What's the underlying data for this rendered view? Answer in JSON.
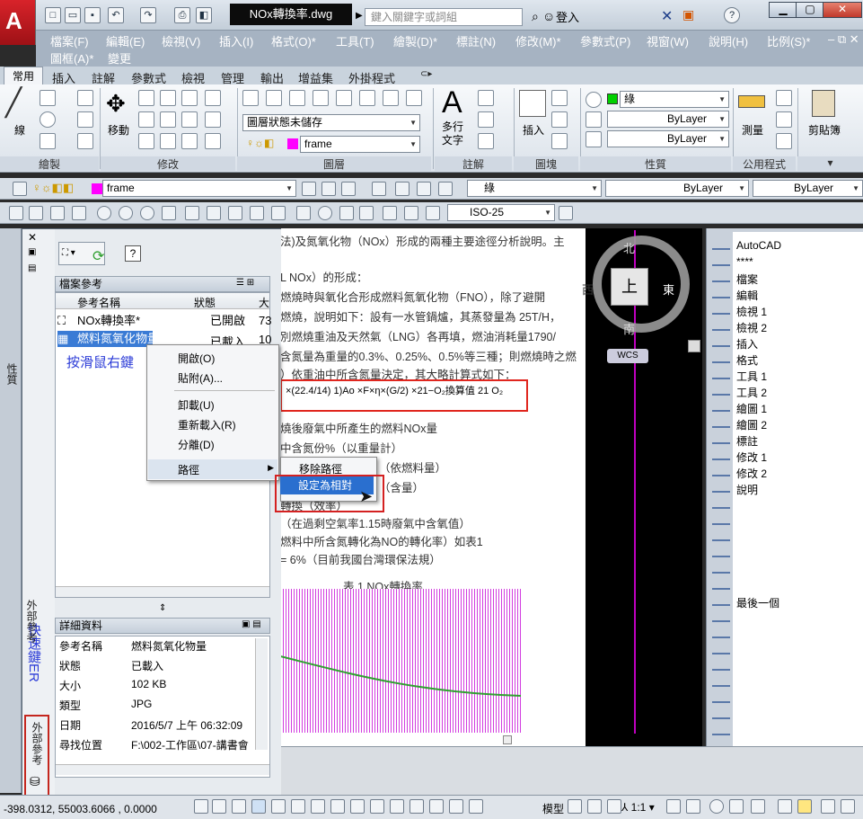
{
  "title_bar": {
    "document_title": "NOx轉換率.dwg",
    "search_placeholder": "鍵入關鍵字或詞組",
    "login_label": "登入",
    "help_label": "?"
  },
  "menu": {
    "row1": [
      "檔案(F)",
      "編輯(E)",
      "檢視(V)",
      "插入(I)",
      "格式(O)*",
      "工具(T)",
      "繪製(D)*",
      "標註(N)",
      "修改(M)*",
      "參數式(P)",
      "視窗(W)",
      "說明(H)",
      "比例(S)*"
    ],
    "row2": [
      "圖框(A)*",
      "變更"
    ]
  },
  "ribbon": {
    "tabs": [
      "常用",
      "插入",
      "註解",
      "參數式",
      "檢視",
      "管理",
      "輸出",
      "增益集",
      "外掛程式"
    ],
    "draw": {
      "line_label": "線",
      "panel": "繪製"
    },
    "modify": {
      "move_label": "移動",
      "panel": "修改"
    },
    "layer": {
      "state_combo": "圖層狀態未儲存",
      "layer_combo": "frame",
      "panel": "圖層"
    },
    "annotation": {
      "mtext_label": "多行\n文字",
      "panel": "註解"
    },
    "block": {
      "insert_label": "插入",
      "panel": "圖塊"
    },
    "properties": {
      "color_combo": "綠",
      "linetype_combo": "ByLayer",
      "lineweight_combo": "ByLayer",
      "panel": "性質"
    },
    "utilities": {
      "measure_label": "測量",
      "panel": "公用程式"
    },
    "clipboard": {
      "paste_label": "剪貼簿"
    }
  },
  "toolbar1": {
    "layer_combo": "frame",
    "color_combo": "綠",
    "linetype_combo": "ByLayer",
    "lineweight_combo": "ByLayer"
  },
  "toolbar2": {
    "dimstyle_combo": "ISO-25"
  },
  "xref_palette": {
    "file_refs_header": "檔案參考",
    "columns": [
      "參考名稱",
      "狀態",
      "大"
    ],
    "rows": [
      {
        "name": "NOx轉換率*",
        "status": "已開啟",
        "size": "73"
      },
      {
        "name": "燃料氮氧化物量",
        "status": "已載入",
        "size": "10"
      }
    ],
    "annotation": "按滑鼠右鍵",
    "details_header": "詳細資料",
    "details": [
      {
        "key": "參考名稱",
        "value": "燃料氮氧化物量"
      },
      {
        "key": "狀態",
        "value": "已載入"
      },
      {
        "key": "大小",
        "value": "102 KB"
      },
      {
        "key": "類型",
        "value": "JPG"
      },
      {
        "key": "日期",
        "value": "2016/5/7 上午 06:32:09"
      },
      {
        "key": "尋找位置",
        "value": "F:\\002-工作區\\07-講書會"
      }
    ],
    "side_tab": "外部參考",
    "shortcut_note": "快速鍵ER"
  },
  "context_menu": {
    "items": [
      "開啟(O)",
      "貼附(A)...",
      "卸載(U)",
      "重新載入(R)",
      "分離(D)",
      "路徑"
    ],
    "submenu": [
      "移除路徑",
      "設定為相對"
    ]
  },
  "drawing": {
    "lines": [
      "法)及氮氧化物（NOx）形成的兩種主要途徑分析說明。主",
      "L NOx）的形成：",
      "燃燒時與氧化合形成燃料氮氧化物（FNO），除了避開",
      "燃燒，說明如下：設有一水管鍋爐，其蒸發量為 25T/H，",
      "別燃燒重油及天然氣（LNG）各再填，燃油消耗量1790/",
      "含氮量為重量的0.3%、0.25%、0.5%等三種；則燃燒時之燃",
      "）依重油中所含氮量決定，其大略計算式如下：",
      "燒後廢氣中所產生的燃料NOx量",
      "中含氮份%（以重量計）",
      "（依燃料量）",
      "（含量）",
      "轉換（效率）",
      "（在過剩空氣率1.15時廢氣中含氧值）",
      "燃料中所含氮轉化為NO的轉化率）如表1",
      "= 6%（目前我國台灣環保法規）",
      "表 1  NOx轉換率"
    ],
    "formula": "×(22.4/14) 1)Ao  ×F×η×(G/2)  ×21−O₂換算值 21   O₂",
    "viewcube": {
      "north": "北",
      "south": "南",
      "east": "東",
      "west": "西",
      "top": "上",
      "wcs": "WCS"
    }
  },
  "tool_palette": {
    "items": [
      "AutoCAD",
      "****",
      "檔案",
      "編輯",
      "檢視 1",
      "檢視 2",
      "插入",
      "格式",
      "工具 1",
      "工具 2",
      "繪圖 1",
      "繪圖 2",
      "標註",
      "修改 1",
      "修改 2",
      "說明"
    ],
    "last": "最後一個"
  },
  "left_strip": {
    "properties_tab": "性質"
  },
  "status_bar": {
    "coords": "-398.0312,  55003.6066 , 0.0000",
    "model_label": "模型",
    "scale_label": "1:1"
  }
}
